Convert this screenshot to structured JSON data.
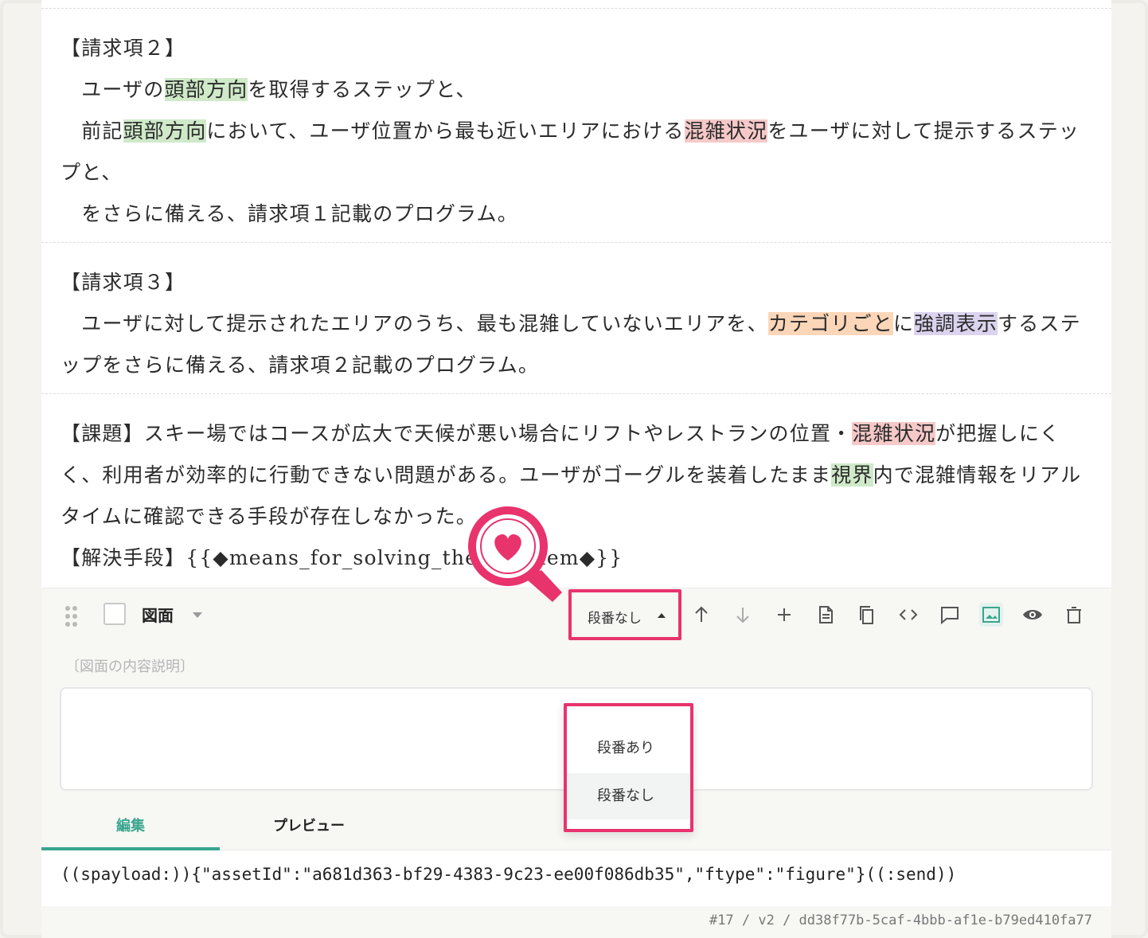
{
  "claims": [
    {
      "heading": "【請求項２】",
      "lines": [
        [
          {
            "t": "　ユーザの"
          },
          {
            "t": "頭部方向",
            "hl": "green"
          },
          {
            "t": "を取得するステップと、"
          }
        ],
        [
          {
            "t": "　前記"
          },
          {
            "t": "頭部方向",
            "hl": "green"
          },
          {
            "t": "において、ユーザ位置から最も近いエリアにおける"
          },
          {
            "t": "混雑状況",
            "hl": "red"
          },
          {
            "t": "をユーザに対して提示するステッ"
          }
        ],
        [
          {
            "t": "プと、"
          }
        ],
        [
          {
            "t": "　をさらに備える、請求項１記載のプログラム。"
          }
        ]
      ]
    },
    {
      "heading": "【請求項３】",
      "lines": [
        [
          {
            "t": "　ユーザに対して提示されたエリアのうち、最も混雑していないエリアを、"
          },
          {
            "t": "カテゴリごと",
            "hl": "orange"
          },
          {
            "t": "に"
          },
          {
            "t": "強調表示",
            "hl": "purple"
          },
          {
            "t": "するステ"
          }
        ],
        [
          {
            "t": "ップをさらに備える、請求項２記載のプログラム。"
          }
        ]
      ]
    },
    {
      "heading": "",
      "lines": [
        [
          {
            "t": "【課題】スキー場ではコースが広大で天候が悪い場合にリフトやレストランの位置・"
          },
          {
            "t": "混雑状況",
            "hl": "red"
          },
          {
            "t": "が把握しにく"
          }
        ],
        [
          {
            "t": "く、利用者が効率的に行動できない問題がある。ユーザがゴーグルを装着したまま"
          },
          {
            "t": "視界",
            "hl": "green"
          },
          {
            "t": "内で混雑情報をリアル"
          }
        ],
        [
          {
            "t": "タイムに確認できる手段が存在しなかった。"
          }
        ],
        [
          {
            "t": "【解決手段】{{◆means_for_solving_the_problem◆}}"
          }
        ]
      ]
    }
  ],
  "block": {
    "type_label": "図面",
    "numbering_label": "段番なし",
    "caption_placeholder": "〔図面の内容説明〕",
    "toolbar_icons": [
      "arrow-up-icon",
      "arrow-down-icon",
      "plus-icon",
      "document-icon",
      "copy-icon",
      "code-icon",
      "comment-icon",
      "image-icon",
      "eye-icon",
      "trash-icon"
    ]
  },
  "dropdown": {
    "options": [
      "段番あり",
      "段番なし"
    ],
    "selected": "段番なし"
  },
  "tabs": {
    "edit": "編集",
    "preview": "プレビュー"
  },
  "code_text": "((spayload:)){\"assetId\":\"a681d363-bf29-4383-9c23-ee00f086db35\",\"ftype\":\"figure\"}((:send))",
  "footer_id": "#17 / v2 / dd38f77b-5caf-4bbb-af1e-b79ed410fa77",
  "colors": {
    "accent": "#3aa58f",
    "highlight_frame": "#e8336d"
  }
}
